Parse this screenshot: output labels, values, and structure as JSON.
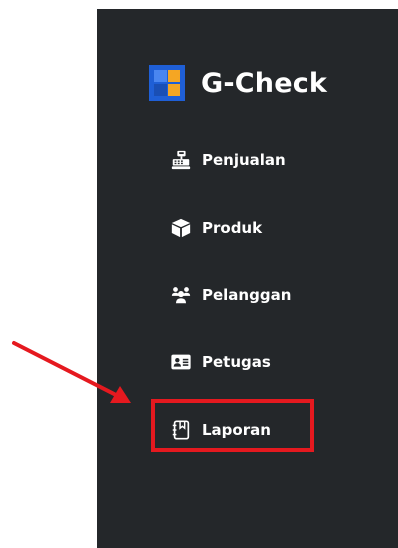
{
  "brand": {
    "name": "G-Check",
    "colors": {
      "blue": "#1f5fd6",
      "orange": "#f5a623"
    }
  },
  "sidebar": {
    "background": "#24272a",
    "items": [
      {
        "label": "Penjualan",
        "icon": "cash-register-icon"
      },
      {
        "label": "Produk",
        "icon": "box-icon"
      },
      {
        "label": "Pelanggan",
        "icon": "users-icon"
      },
      {
        "label": "Petugas",
        "icon": "id-card-icon"
      },
      {
        "label": "Laporan",
        "icon": "notebook-icon"
      }
    ]
  },
  "annotation": {
    "highlight_color": "#e5191f",
    "target_item": "Laporan"
  }
}
